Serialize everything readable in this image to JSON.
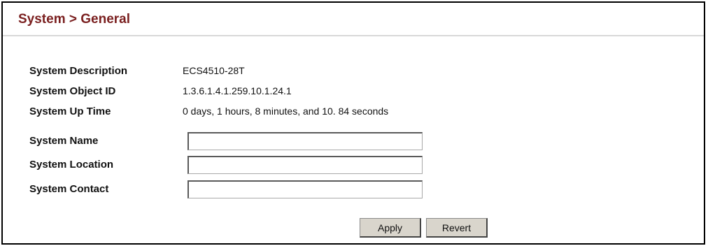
{
  "page": {
    "title": "System > General"
  },
  "fields": {
    "description": {
      "label": "System Description",
      "value": "ECS4510-28T"
    },
    "object_id": {
      "label": "System Object ID",
      "value": "1.3.6.1.4.1.259.10.1.24.1"
    },
    "up_time": {
      "label": "System Up Time",
      "value": "0 days, 1 hours, 8 minutes, and 10. 84 seconds"
    },
    "name": {
      "label": "System Name",
      "value": ""
    },
    "location": {
      "label": "System Location",
      "value": ""
    },
    "contact": {
      "label": "System Contact",
      "value": ""
    }
  },
  "buttons": {
    "apply": "Apply",
    "revert": "Revert"
  },
  "colors": {
    "title": "#7a1f1f",
    "button_face": "#d9d5cc",
    "frame_border": "#000000"
  }
}
